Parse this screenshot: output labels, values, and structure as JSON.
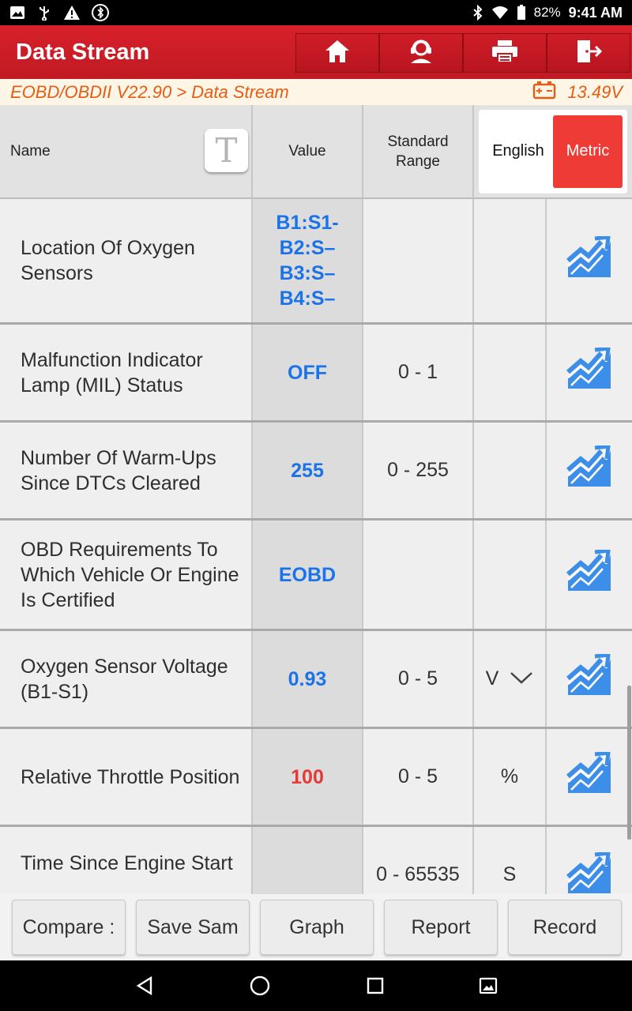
{
  "status_bar": {
    "battery": "82%",
    "time": "9:41 AM",
    "icons": [
      "image-icon",
      "usb-icon",
      "warning-icon",
      "bluetooth-icon",
      "bluetooth-icon",
      "wifi-icon",
      "battery-icon"
    ]
  },
  "app_bar": {
    "title": "Data Stream",
    "buttons": [
      "home-icon",
      "support-icon",
      "print-icon",
      "exit-icon"
    ]
  },
  "breadcrumb": {
    "path": "EOBD/OBDII V22.90 > Data Stream",
    "voltage": "13.49V",
    "voltage_icon": "battery-icon"
  },
  "table_header": {
    "name": "Name",
    "font_button": "T",
    "value": "Value",
    "standard_range": "Standard Range",
    "unit_toggle": {
      "english": "English",
      "metric": "Metric",
      "selected": "Metric"
    }
  },
  "rows": [
    {
      "name": "Location Of Oxygen Sensors",
      "value": "B1:S1- B2:S– B3:S– B4:S–",
      "range": "",
      "unit": ""
    },
    {
      "name": "Malfunction Indicator Lamp (MIL) Status",
      "value": "OFF",
      "range": "0 - 1",
      "unit": ""
    },
    {
      "name": "Number Of Warm-Ups Since DTCs Cleared",
      "value": "255",
      "range": "0 - 255",
      "unit": ""
    },
    {
      "name": "OBD Requirements To Which Vehicle Or Engine Is Certified",
      "value": "EOBD",
      "range": "",
      "unit": ""
    },
    {
      "name": "Oxygen Sensor Voltage (B1-S1)",
      "value": "0.93",
      "range": "0 - 5",
      "unit": "V"
    },
    {
      "name": "Relative Throttle Position",
      "value": "100",
      "range": "0 - 5",
      "unit": "%"
    },
    {
      "name": "Time Since Engine Start",
      "value": "",
      "range": "0 - 65535",
      "unit": "S"
    }
  ],
  "colors": {
    "value_normal": "#1a73e8",
    "value_out_of_range": "#e53935",
    "brand_red": "#c8102e",
    "accent_orange": "#e65c13"
  },
  "actions": {
    "compare": "Compare :",
    "save_sample": "Save Sam",
    "graph": "Graph",
    "report": "Report",
    "record": "Record"
  }
}
